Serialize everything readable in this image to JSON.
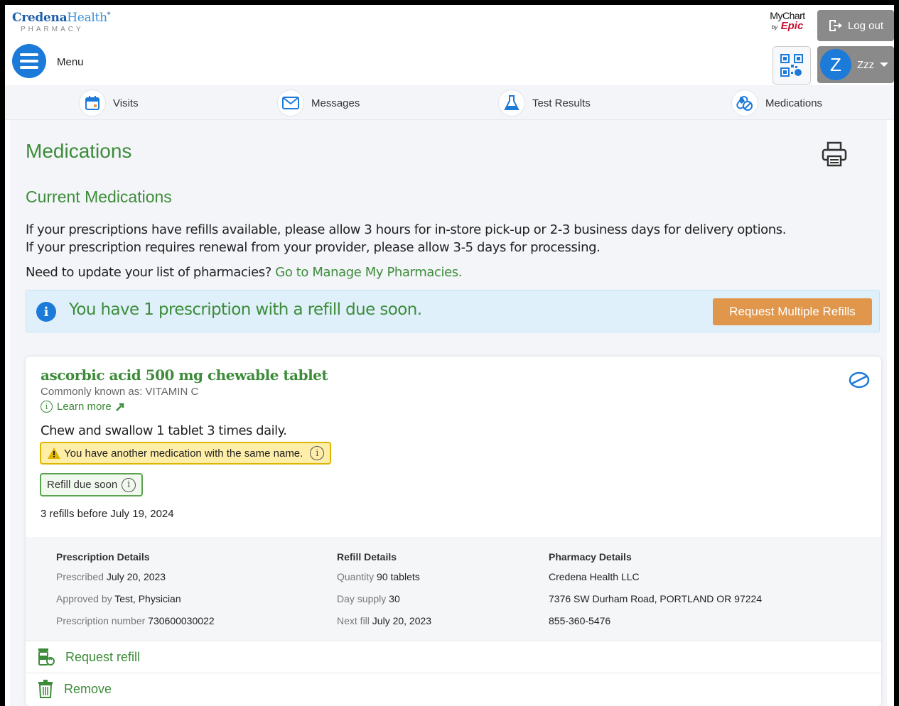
{
  "header": {
    "brand_name": "Credena",
    "brand_name_2": "Health",
    "brand_mark": "*",
    "brand_sub": "PHARMACY",
    "menu_label": "Menu",
    "mychart_label": "MyChart",
    "mychart_by": "by",
    "mychart_epic": "Epic",
    "logout_label": "Log out",
    "user_initial": "Z",
    "user_name": "Zzz"
  },
  "nav": {
    "items": [
      {
        "label": "Visits",
        "icon": "calendar-icon"
      },
      {
        "label": "Messages",
        "icon": "envelope-icon"
      },
      {
        "label": "Test Results",
        "icon": "flask-icon"
      },
      {
        "label": "Medications",
        "icon": "pills-icon"
      }
    ]
  },
  "page": {
    "title": "Medications",
    "section_title": "Current Medications",
    "info_line_1": "If your prescriptions have refills available, please allow 3 hours for in-store pick-up or 2-3 business days for delivery options.",
    "info_line_2": "If your prescription requires renewal from your provider, please allow 3-5 days for processing.",
    "pharm_question": "Need to update your list of pharmacies?",
    "pharm_link": "Go to Manage My Pharmacies."
  },
  "alert": {
    "text": "You have 1 prescription with a refill due soon.",
    "button_label": "Request Multiple Refills"
  },
  "medication": {
    "name": "ascorbic acid 500 mg chewable tablet",
    "known_as": "Commonly known as: VITAMIN C",
    "learn_more": "Learn more",
    "sig": "Chew and swallow 1 tablet 3 times daily.",
    "warning": "You have another medication with the same name.",
    "refill_badge": "Refill due soon",
    "refills_before": "3 refills before July 19, 2024",
    "prescription_details": {
      "heading": "Prescription Details",
      "prescribed_label": "Prescribed",
      "prescribed_value": "July 20, 2023",
      "approved_label": "Approved by",
      "approved_value": "Test, Physician",
      "number_label": "Prescription number",
      "number_value": "730600030022"
    },
    "refill_details": {
      "heading": "Refill Details",
      "quantity_label": "Quantity",
      "quantity_value": "90 tablets",
      "supply_label": "Day supply",
      "supply_value": "30",
      "next_label": "Next fill",
      "next_value": "July 20, 2023"
    },
    "pharmacy_details": {
      "heading": "Pharmacy Details",
      "name": "Credena Health LLC",
      "address": "7376 SW Durham Road, PORTLAND OR 97224",
      "phone": "855-360-5476"
    },
    "actions": {
      "request_refill": "Request refill",
      "remove": "Remove"
    }
  },
  "colors": {
    "accent_green": "#3d8c3a",
    "primary_blue": "#1c7ad9",
    "orange_button": "#e0974c",
    "alert_bg": "#dff0fa",
    "warning_bg": "#ffeea8"
  }
}
